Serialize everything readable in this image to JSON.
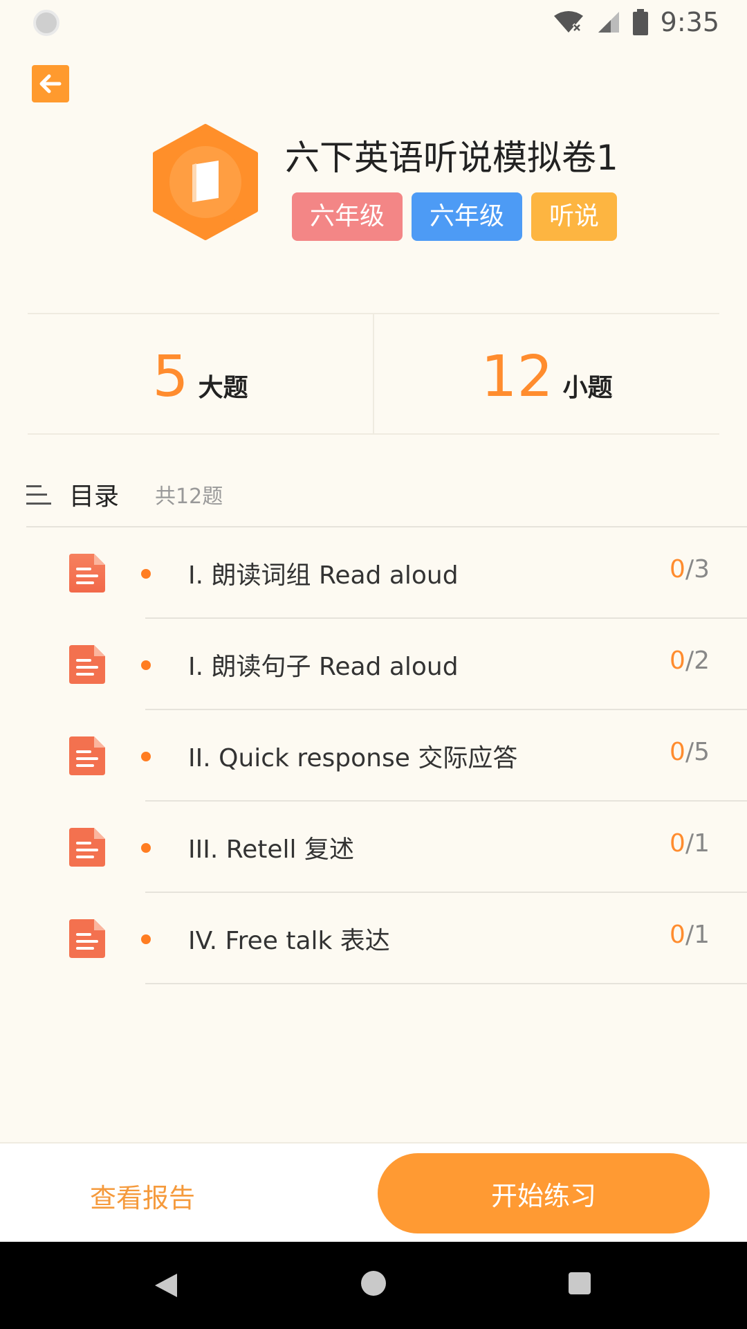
{
  "status_bar": {
    "time": "9:35"
  },
  "header": {
    "title": "六下英语听说模拟卷1",
    "tags": [
      "六年级",
      "六年级",
      "听说"
    ]
  },
  "stats": {
    "big_count": "5",
    "big_label": "大题",
    "small_count": "12",
    "small_label": "小题"
  },
  "catalog": {
    "title": "目录",
    "count": "共12题",
    "items": [
      {
        "label": "I. 朗读词组 Read aloud",
        "done": "0",
        "total": "/3"
      },
      {
        "label": "I. 朗读句子 Read aloud",
        "done": "0",
        "total": "/2"
      },
      {
        "label": "II. Quick response 交际应答",
        "done": "0",
        "total": "/5"
      },
      {
        "label": "III. Retell 复述",
        "done": "0",
        "total": "/1"
      },
      {
        "label": "IV. Free talk 表达",
        "done": "0",
        "total": "/1"
      }
    ]
  },
  "actions": {
    "report": "查看报告",
    "start": "开始练习"
  },
  "colors": {
    "accent": "#ff9a33",
    "tag_red": "#f38686",
    "tag_blue": "#4d9bf5",
    "tag_orange": "#fdb541"
  }
}
